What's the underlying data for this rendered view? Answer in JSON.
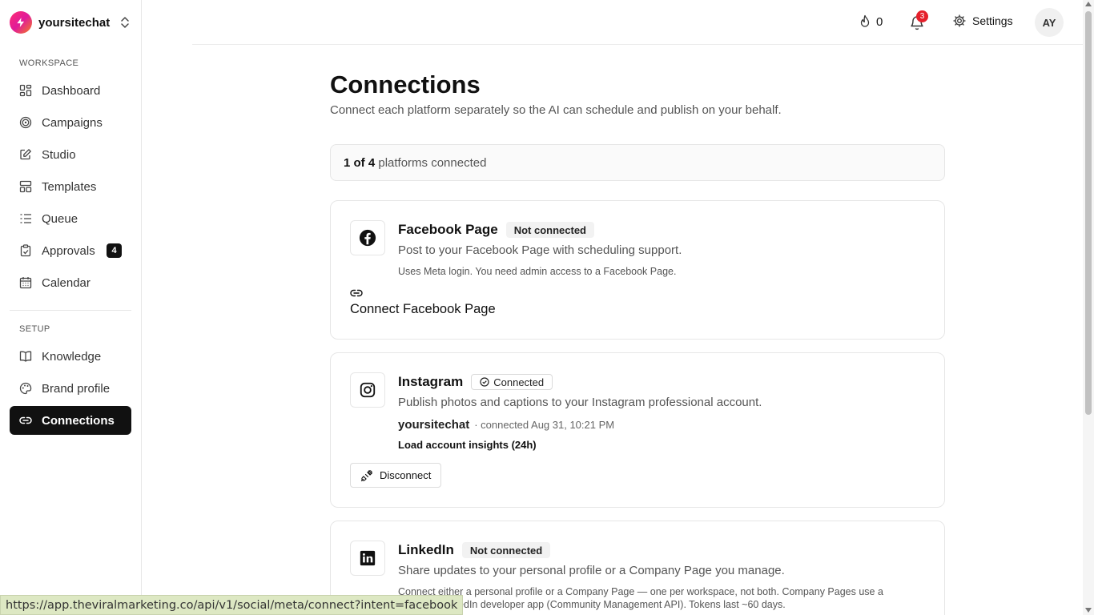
{
  "workspace": {
    "name": "yoursitechat"
  },
  "sidebar": {
    "workspace_label": "WORKSPACE",
    "setup_label": "SETUP",
    "items": [
      {
        "label": "Dashboard",
        "icon": "dashboard-icon"
      },
      {
        "label": "Campaigns",
        "icon": "target-icon"
      },
      {
        "label": "Studio",
        "icon": "edit-icon"
      },
      {
        "label": "Templates",
        "icon": "layout-icon"
      },
      {
        "label": "Queue",
        "icon": "list-icon"
      },
      {
        "label": "Approvals",
        "icon": "clipboard-check-icon",
        "badge": "4"
      },
      {
        "label": "Calendar",
        "icon": "calendar-icon"
      }
    ],
    "setup_items": [
      {
        "label": "Knowledge",
        "icon": "book-icon"
      },
      {
        "label": "Brand profile",
        "icon": "palette-icon"
      },
      {
        "label": "Connections",
        "icon": "link-icon",
        "active": true
      }
    ]
  },
  "header": {
    "credits": "0",
    "notifications_count": "3",
    "settings_label": "Settings",
    "avatar_initials": "AY"
  },
  "main": {
    "title": "Connections",
    "subtitle": "Connect each platform separately so the AI can schedule and publish on your behalf.",
    "summary": {
      "connected": "1 of 4",
      "text": "platforms connected"
    },
    "cards": [
      {
        "name": "Facebook Page",
        "status": "Not connected",
        "description": "Post to your Facebook Page with scheduling support.",
        "note": "Uses Meta login. You need admin access to a Facebook Page.",
        "action": "Connect Facebook Page"
      },
      {
        "name": "Instagram",
        "status": "Connected",
        "description": "Publish photos and captions to your Instagram professional account.",
        "account": "yoursitechat",
        "account_meta": "· connected Aug 31, 10:21 PM",
        "insights_label": "Load account insights (24h)",
        "action": "Disconnect"
      },
      {
        "name": "LinkedIn",
        "status": "Not connected",
        "description": "Share updates to your personal profile or a Company Page you manage.",
        "note": "Connect either a personal profile or a Company Page — one per workspace, not both. Company Pages use a separate LinkedIn developer app (Community Management API). Tokens last ~60 days."
      }
    ]
  },
  "status_bar": {
    "url": "https://app.theviralmarketing.co/api/v1/social/meta/connect?intent=facebook"
  },
  "colors": {
    "accent": "#111111",
    "notification": "#e5202b",
    "brand_gradient_start": "#ff2d6f",
    "brand_gradient_end": "#f47c20"
  }
}
